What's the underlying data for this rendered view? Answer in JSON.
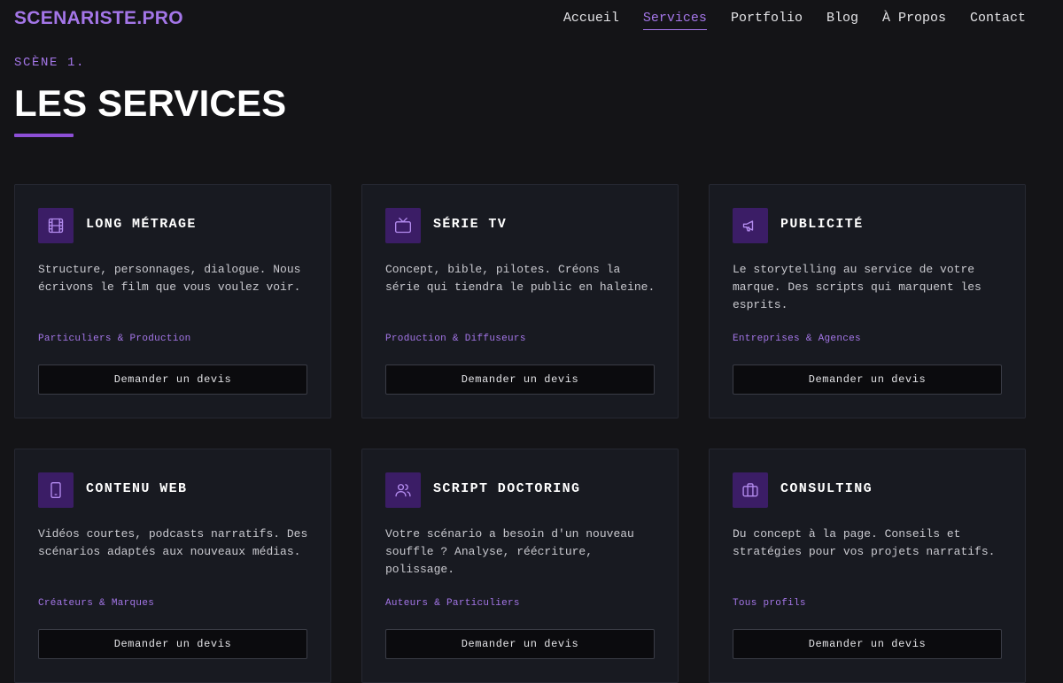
{
  "header": {
    "logo": "SCENARISTE.PRO",
    "nav": [
      {
        "label": "Accueil",
        "active": false
      },
      {
        "label": "Services",
        "active": true
      },
      {
        "label": "Portfolio",
        "active": false
      },
      {
        "label": "Blog",
        "active": false
      },
      {
        "label": "À Propos",
        "active": false
      },
      {
        "label": "Contact",
        "active": false
      }
    ]
  },
  "hero": {
    "scene_label": "SCÈNE 1.",
    "title": "LES SERVICES"
  },
  "colors": {
    "accent": "#a476e8",
    "icon_bg": "#3b1d66",
    "background": "#141417",
    "card_bg": "#181a21"
  },
  "cards": [
    {
      "icon": "film-icon",
      "title": "LONG MÉTRAGE",
      "description": "Structure, personnages, dialogue. Nous écrivons le film que vous voulez voir.",
      "audience": "Particuliers & Production",
      "button": "Demander un devis"
    },
    {
      "icon": "tv-icon",
      "title": "SÉRIE TV",
      "description": "Concept, bible, pilotes. Créons la série qui tiendra le public en haleine.",
      "audience": "Production & Diffuseurs",
      "button": "Demander un devis"
    },
    {
      "icon": "megaphone-icon",
      "title": "PUBLICITÉ",
      "description": "Le storytelling au service de votre marque. Des scripts qui marquent les esprits.",
      "audience": "Entreprises & Agences",
      "button": "Demander un devis"
    },
    {
      "icon": "smartphone-icon",
      "title": "CONTENU WEB",
      "description": "Vidéos courtes, podcasts narratifs. Des scénarios adaptés aux nouveaux médias.",
      "audience": "Créateurs & Marques",
      "button": "Demander un devis"
    },
    {
      "icon": "users-icon",
      "title": "SCRIPT DOCTORING",
      "description": "Votre scénario a besoin d'un nouveau souffle ? Analyse, réécriture, polissage.",
      "audience": "Auteurs & Particuliers",
      "button": "Demander un devis"
    },
    {
      "icon": "briefcase-icon",
      "title": "CONSULTING",
      "description": "Du concept à la page. Conseils et stratégies pour vos projets narratifs.",
      "audience": "Tous profils",
      "button": "Demander un devis"
    }
  ]
}
